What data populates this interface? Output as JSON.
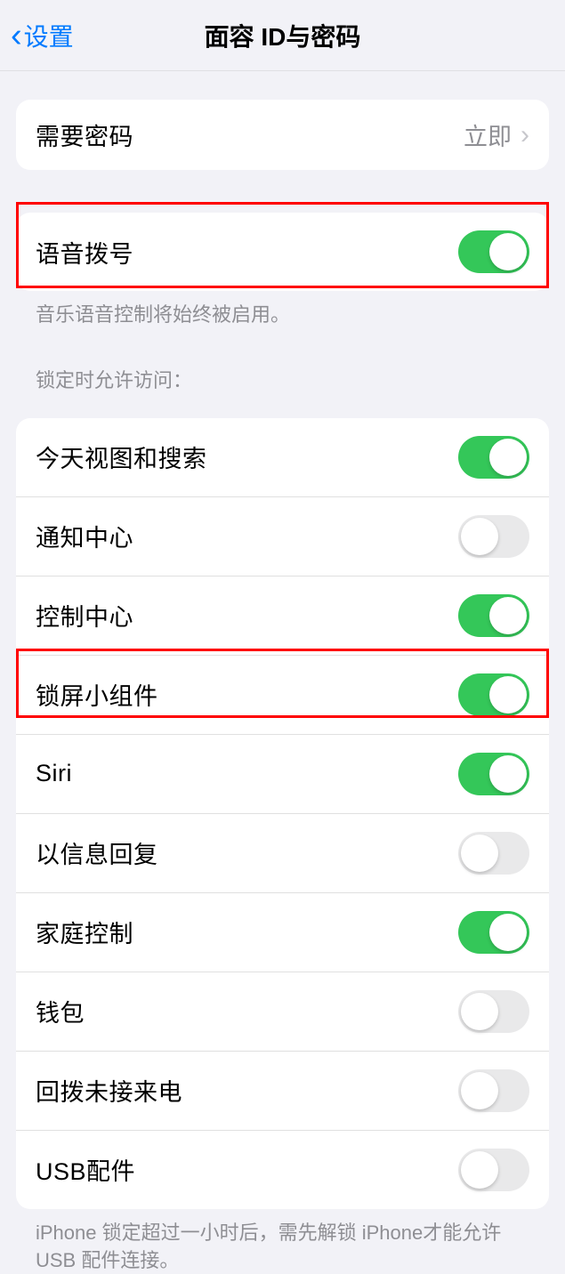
{
  "header": {
    "back_label": "设置",
    "title": "面容 ID与密码"
  },
  "require_passcode": {
    "label": "需要密码",
    "value": "立即"
  },
  "voice_dial": {
    "label": "语音拨号",
    "footer": "音乐语音控制将始终被启用。"
  },
  "lock_screen_section": {
    "header": "锁定时允许访问：",
    "items": [
      {
        "label": "今天视图和搜索",
        "on": true
      },
      {
        "label": "通知中心",
        "on": false
      },
      {
        "label": "控制中心",
        "on": true
      },
      {
        "label": "锁屏小组件",
        "on": true
      },
      {
        "label": "Siri",
        "on": true
      },
      {
        "label": "以信息回复",
        "on": false
      },
      {
        "label": "家庭控制",
        "on": true
      },
      {
        "label": "钱包",
        "on": false
      },
      {
        "label": "回拨未接来电",
        "on": false
      },
      {
        "label": "USB配件",
        "on": false
      }
    ],
    "footer": "iPhone 锁定超过一小时后，需先解锁 iPhone才能允许USB 配件连接。"
  }
}
